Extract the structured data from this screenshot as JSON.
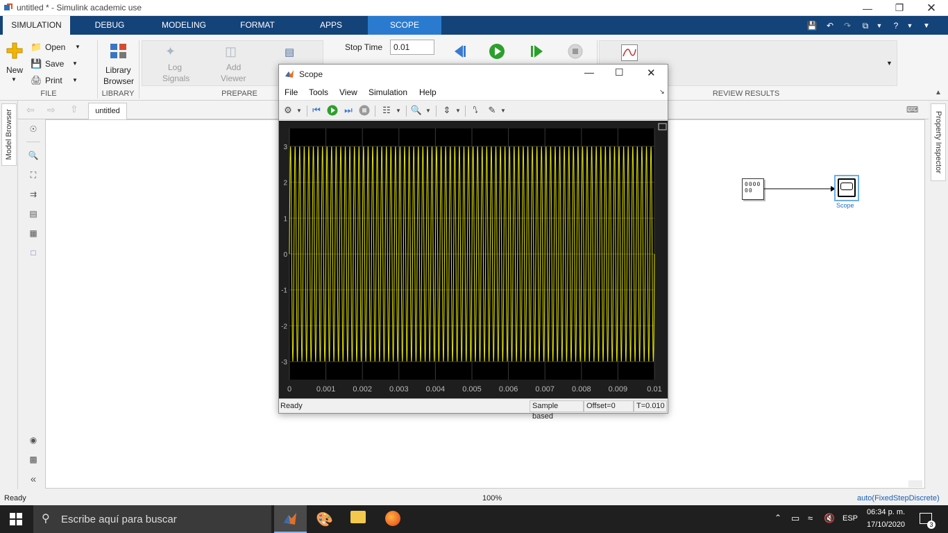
{
  "window": {
    "title": "untitled * - Simulink academic use"
  },
  "tabs": [
    {
      "label": "SIMULATION"
    },
    {
      "label": "DEBUG"
    },
    {
      "label": "MODELING"
    },
    {
      "label": "FORMAT"
    },
    {
      "label": "APPS"
    },
    {
      "label": "SCOPE"
    }
  ],
  "ribbon": {
    "new_label": "New",
    "open_label": "Open",
    "save_label": "Save",
    "print_label": "Print",
    "file_section": "FILE",
    "library_browser_1": "Library",
    "library_browser_2": "Browser",
    "library_section": "LIBRARY",
    "log_signals_1": "Log",
    "log_signals_2": "Signals",
    "add_viewer_1": "Add",
    "add_viewer_2": "Viewer",
    "prepare_section": "PREPARE",
    "stop_time_label": "Stop Time",
    "stop_time_value": "0.01",
    "review_section": "REVIEW RESULTS"
  },
  "doc": {
    "tab_label": "untitled",
    "model_browser": "Model Browser",
    "property_inspector": "Property Inspector"
  },
  "model": {
    "scope_block_label": "Scope",
    "source_block_text": "0000 00"
  },
  "status": {
    "left": "Ready",
    "zoom": "100%",
    "solver": "auto(FixedStepDiscrete)"
  },
  "taskbar": {
    "search_placeholder": "Escribe aquí para buscar",
    "language": "ESP",
    "time": "06:34 p. m.",
    "date": "17/10/2020",
    "notifications": "3"
  },
  "scope": {
    "title": "Scope",
    "menu": [
      "File",
      "Tools",
      "View",
      "Simulation",
      "Help"
    ],
    "status_left": "Ready",
    "status_sample": "Sample based",
    "status_offset": "Offset=0",
    "status_time": "T=0.010"
  },
  "chart_data": {
    "type": "line",
    "xlim": [
      0,
      0.01
    ],
    "ylim": [
      -3.5,
      3.5
    ],
    "xticks": [
      "0",
      "0.001",
      "0.002",
      "0.003",
      "0.004",
      "0.005",
      "0.006",
      "0.007",
      "0.008",
      "0.009",
      "0.01"
    ],
    "yticks": [
      "3",
      "2",
      "1",
      "0",
      "-1",
      "-2",
      "-3"
    ],
    "grid": true,
    "series": [
      {
        "amplitude": 3,
        "frequency_hz": 8000,
        "color": "#e6e600"
      }
    ]
  }
}
